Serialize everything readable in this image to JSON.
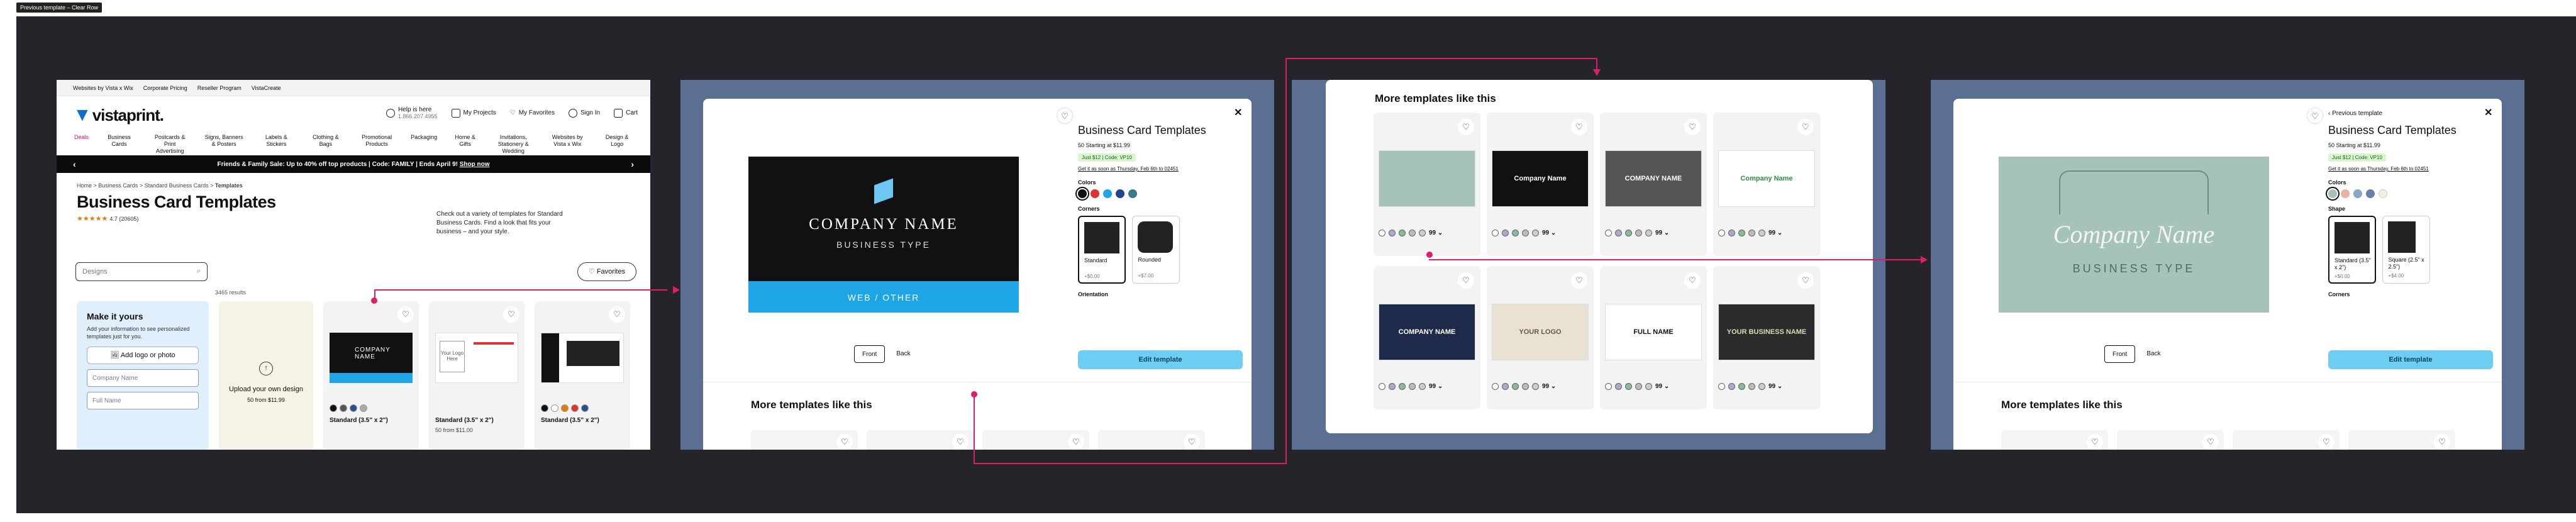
{
  "frame_label": "Previous template – Clear Row",
  "site": {
    "top_links": [
      "Websites by Vista x Wix",
      "Corporate Pricing",
      "Reseller Program",
      "VistaCreate"
    ],
    "logo": "vistaprint.",
    "help": "Help is here",
    "phone": "1.866.207.4955",
    "my_projects": "My Projects",
    "my_favorites": "My Favorites",
    "sign_in": "Sign In",
    "cart": "Cart",
    "cart_count": "0",
    "categories": [
      "Deals",
      "Business Cards",
      "Postcards & Print Advertising",
      "Signs, Banners & Posters",
      "Labels & Stickers",
      "Clothing & Bags",
      "Promotional Products",
      "Packaging",
      "Home & Gifts",
      "Invitations, Stationery & Wedding",
      "Websites by Vista x Wix",
      "Design & Logo"
    ],
    "promo": "Friends & Family Sale: Up to 40% off top products | Code: FAMILY | Ends April 9!",
    "promo_link": "Shop now",
    "breadcrumbs": [
      "Home",
      "Business Cards",
      "Standard Business Cards",
      "Templates"
    ],
    "page_title": "Business Card Templates",
    "rating": "4.7 (20605)",
    "intro": "Check out a variety of templates for Standard Business Cards. Find a look that fits your business – and your style.",
    "search_placeholder": "Designs",
    "favorites_btn": "Favorites",
    "results": "3465 results",
    "make_it_yours": {
      "title": "Make it yours",
      "body": "Add your information to see personalized templates just for you.",
      "add_logo": "Add logo or photo",
      "company_placeholder": "Company Name",
      "name_placeholder": "Full Name"
    },
    "upload": {
      "title": "Upload your own design",
      "price": "50 from $11.99"
    },
    "cards": [
      {
        "name": "Standard (3.5\" x 2\")",
        "price": ""
      },
      {
        "name": "Standard (3.5\" x 2\")",
        "price": "50 from $11.00"
      },
      {
        "name": "Standard (3.5\" x 2\")",
        "price": ""
      }
    ]
  },
  "modal1": {
    "card_company": "COMPANY NAME",
    "card_type": "BUSINESS TYPE",
    "card_web": "WEB / OTHER",
    "title": "Business Card Templates",
    "price": "50 Starting at $11.99",
    "badge": "Just $12 | Code: VP10",
    "delivery": "Get it as soon as Thursday, Feb 6th to 02451",
    "colors_label": "Colors",
    "corners_label": "Corners",
    "corner_standard": "Standard",
    "corner_standard_price": "+$0.00",
    "corner_rounded": "Rounded",
    "corner_rounded_price": "+$7.00",
    "orientation_label": "Orientation",
    "front": "Front",
    "back": "Back",
    "cta": "Edit template",
    "more": "More templates like this"
  },
  "modal2": {
    "more": "More templates like this",
    "count_badge": "99",
    "cards": [
      {
        "thumb": "house-sketch"
      },
      {
        "thumb": "key-company",
        "text": "Company Name"
      },
      {
        "thumb": "gray-company",
        "text": "COMPANY NAME"
      },
      {
        "thumb": "green-company",
        "text": "Company Name"
      },
      {
        "thumb": "navy-company",
        "text": "COMPANY NAME"
      },
      {
        "thumb": "beige-company",
        "text": "YOUR LOGO"
      },
      {
        "thumb": "photo-company",
        "text": "FULL NAME"
      },
      {
        "thumb": "dark-logo",
        "text": "YOUR BUSINESS NAME"
      }
    ]
  },
  "modal3": {
    "prev": "Previous template",
    "card_company": "Company Name",
    "card_type": "BUSINESS TYPE",
    "title": "Business Card Templates",
    "price": "50 Starting at $11.99",
    "badge": "Just $12 | Code: VP10",
    "delivery": "Get it as soon as Thursday, Feb 6th to 02451",
    "colors_label": "Colors",
    "shape_label": "Shape",
    "shape_standard": "Standard (3.5\" x 2\")",
    "shape_standard_price": "+$0.00",
    "shape_square": "Square (2.5\" x 2.5\")",
    "shape_square_price": "+$4.00",
    "corners_label": "Corners",
    "front": "Front",
    "back": "Back",
    "cta": "Edit template",
    "more": "More templates like this"
  },
  "colors": {
    "accent": "#e01d68",
    "cta": "#6ecdf2",
    "panel_bg": "#5a6f92",
    "board": "#24242a"
  }
}
